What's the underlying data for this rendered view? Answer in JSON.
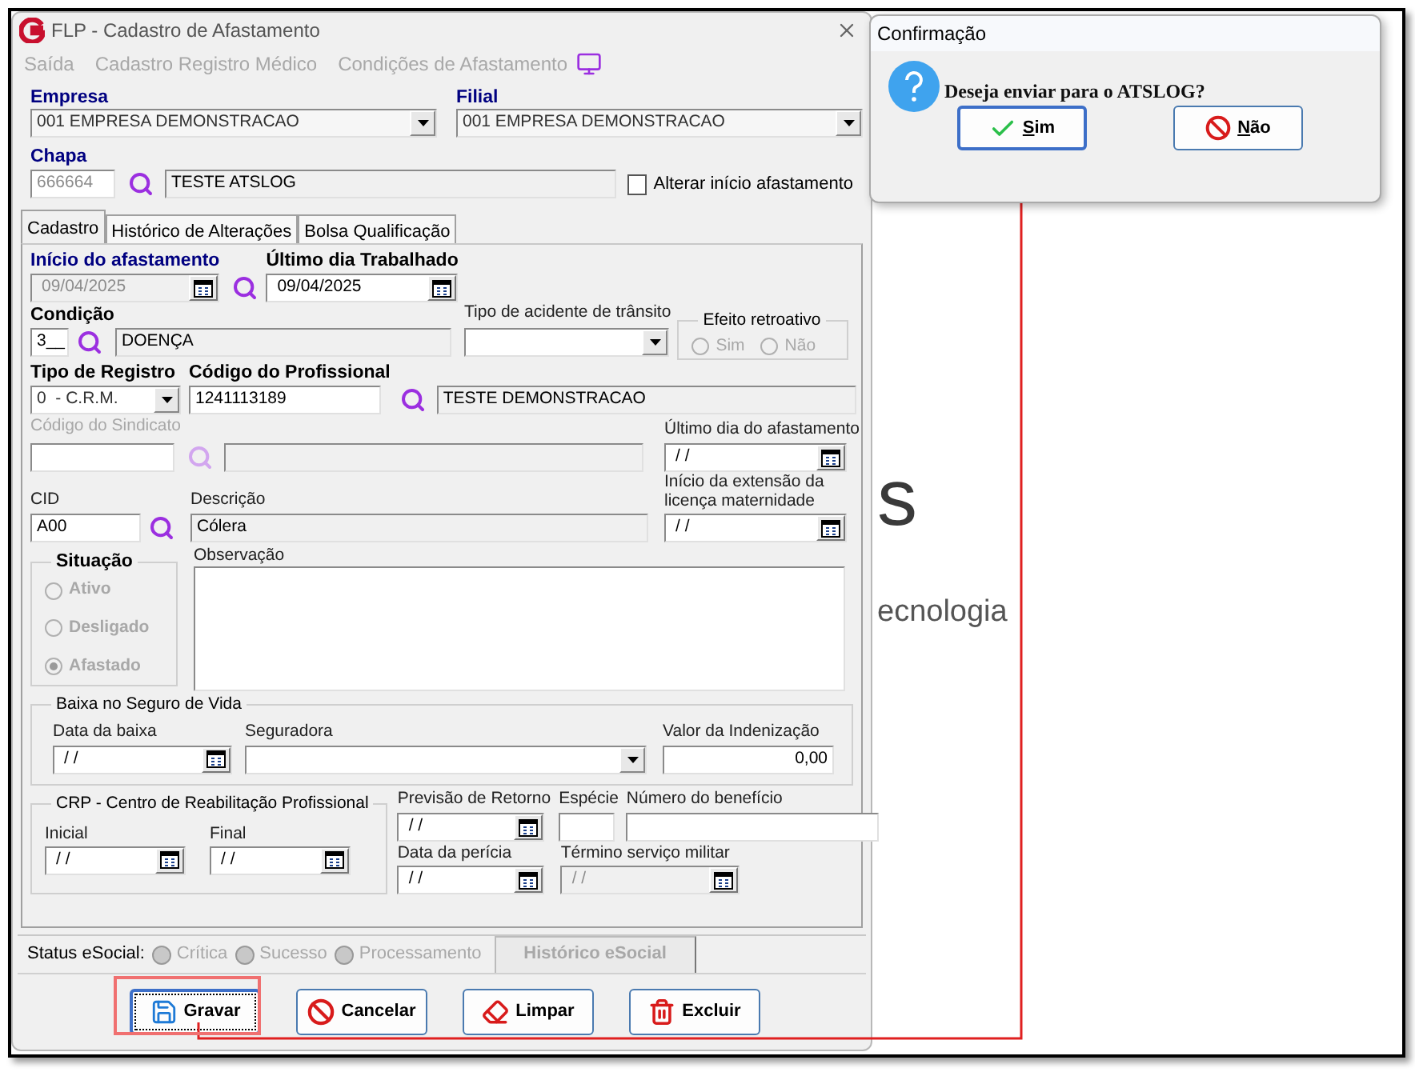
{
  "window": {
    "title": "FLP - Cadastro de Afastamento"
  },
  "menu": [
    "Saída",
    "Cadastro Registro Médico",
    "Condições de Afastamento"
  ],
  "empresa": {
    "label": "Empresa",
    "value": "001 EMPRESA DEMONSTRACAO"
  },
  "filial": {
    "label": "Filial",
    "value": "001 EMPRESA DEMONSTRACAO"
  },
  "chapa": {
    "label": "Chapa",
    "code": "666664",
    "name": "TESTE ATSLOG",
    "disabled": true
  },
  "alterar_inicio": {
    "label": "Alterar início afastamento",
    "checked": false
  },
  "tabs": [
    {
      "label": "Cadastro",
      "selected": true
    },
    {
      "label": "Histórico de Alterações",
      "selected": false
    },
    {
      "label": "Bolsa Qualificação",
      "selected": false
    }
  ],
  "inicio": {
    "label": "Início do afastamento",
    "value": "09/04/2025",
    "disabled": true
  },
  "ultimo_trabalhado": {
    "label": "Último dia Trabalhado",
    "value": "09/04/2025",
    "disabled": false
  },
  "condicao": {
    "label": "Condição",
    "code": "3__",
    "description": "DOENÇA"
  },
  "tipo_acidente": {
    "label": "Tipo de acidente de trânsito"
  },
  "efeito_retroativo": {
    "title": "Efeito retroativo",
    "disabled": true,
    "options": [
      {
        "label": "Sim",
        "selected": false
      },
      {
        "label": "Não",
        "selected": false
      }
    ]
  },
  "tipo_registro": {
    "label": "Tipo de Registro",
    "value": "0  - C.R.M."
  },
  "codigo_profissional": {
    "label": "Código do Profissional",
    "code": "1241113189",
    "name": "TESTE DEMONSTRACAO"
  },
  "codigo_sindicato": {
    "label": "Código do Sindicato",
    "disabled": true
  },
  "ultimo_afastamento": {
    "label": "Último dia do afastamento",
    "value": "/ /",
    "disabled": false
  },
  "extensao_licenca": {
    "label": "Início da extensão da licença maternidade",
    "value": "/ /",
    "disabled": false
  },
  "cid": {
    "label": "CID",
    "value": "A00"
  },
  "descricao": {
    "label": "Descrição",
    "value": "Cólera"
  },
  "situacao": {
    "title": "Situação",
    "disabled": true,
    "options": [
      {
        "label": "Ativo",
        "selected": false
      },
      {
        "label": "Desligado",
        "selected": false
      },
      {
        "label": "Afastado",
        "selected": true
      }
    ]
  },
  "observacao": {
    "label": "Observação"
  },
  "seguro_vida": {
    "title": "Baixa no Seguro de Vida",
    "data_baixa": {
      "label": "Data da baixa",
      "value": "/ /",
      "disabled": false
    },
    "seguradora": {
      "label": "Seguradora"
    },
    "valor": {
      "label": "Valor da Indenização",
      "value": "0,00"
    }
  },
  "crp": {
    "title": "CRP - Centro de Reabilitação Profissional",
    "inicial": {
      "label": "Inicial",
      "value": "/ /",
      "disabled": false
    },
    "final": {
      "label": "Final",
      "value": "/ /",
      "disabled": false
    }
  },
  "previsao_retorno": {
    "label": "Previsão de Retorno",
    "value": "/ /",
    "disabled": false
  },
  "especie": {
    "label": "Espécie"
  },
  "numero_beneficio": {
    "label": "Número do benefício"
  },
  "data_pericia": {
    "label": "Data da perícia",
    "value": "/ /",
    "disabled": false
  },
  "termino_militar": {
    "label": "Término serviço militar",
    "value": "/ /",
    "disabled": true
  },
  "status_esocial": {
    "label": "Status eSocial:",
    "indicators": [
      "Crítica",
      "Sucesso",
      "Processamento"
    ],
    "history_button": "Histórico eSocial"
  },
  "buttons": [
    {
      "label": "Gravar",
      "kind": "save",
      "focused": true
    },
    {
      "label": "Cancelar",
      "kind": "cancel",
      "focused": false
    },
    {
      "label": "Limpar",
      "kind": "clear",
      "focused": false
    },
    {
      "label": "Excluir",
      "kind": "delete",
      "focused": false
    }
  ],
  "dialog": {
    "title": "Confirmação",
    "message": "Deseja enviar para o ATSLOG?",
    "buttons": [
      {
        "label": "Sim",
        "kind": "yes",
        "focused": true
      },
      {
        "label": "Não",
        "kind": "no",
        "focused": false
      }
    ]
  },
  "background_text": [
    "s",
    "ecnologia"
  ]
}
